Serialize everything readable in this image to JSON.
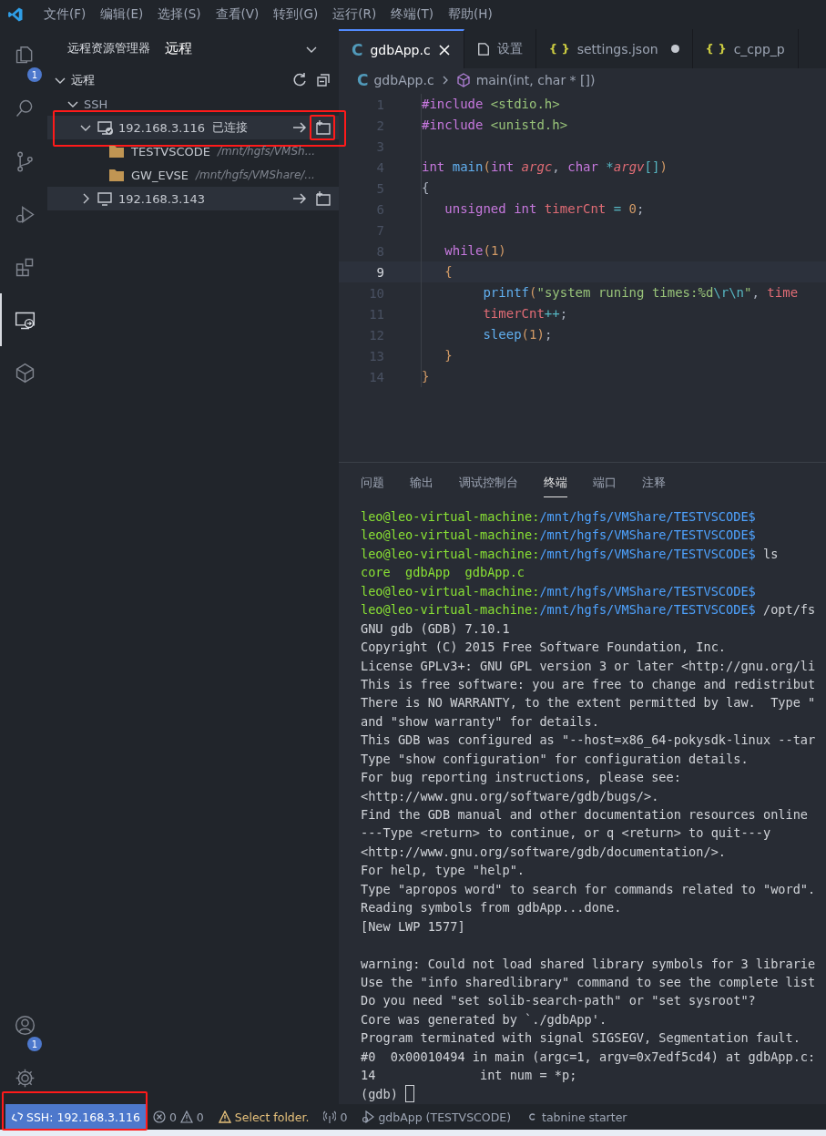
{
  "menubar": {
    "items": [
      "文件(F)",
      "编辑(E)",
      "选择(S)",
      "查看(V)",
      "转到(G)",
      "运行(R)",
      "终端(T)",
      "帮助(H)"
    ]
  },
  "activity_bar": {
    "top": [
      {
        "kind": "files",
        "selected": false,
        "badge": "1"
      },
      {
        "kind": "search",
        "selected": false
      },
      {
        "kind": "source-control",
        "selected": false
      },
      {
        "kind": "run-debug",
        "selected": false
      },
      {
        "kind": "extensions",
        "selected": false
      },
      {
        "kind": "remote",
        "selected": true
      },
      {
        "kind": "cube",
        "selected": false
      }
    ],
    "bottom": [
      {
        "kind": "account",
        "selected": false,
        "badge": "1"
      },
      {
        "kind": "settings",
        "selected": false
      }
    ]
  },
  "sidebar": {
    "title": "远程资源管理器",
    "view": "远程",
    "tree": [
      {
        "kind": "section",
        "label": "远程",
        "expanded": true,
        "children": [
          {
            "kind": "group",
            "label": "SSH",
            "expanded": true,
            "children": [
              {
                "kind": "host",
                "label": "192.168.3.116",
                "status": "已连接",
                "connected": true,
                "expanded": true,
                "highlighted": true,
                "children": [
                  {
                    "kind": "folder",
                    "label": "TESTVSCODE",
                    "description": "/mnt/hgfs/VMSh..."
                  },
                  {
                    "kind": "folder",
                    "label": "GW_EVSE",
                    "description": "/mnt/hgfs/VMShare/..."
                  }
                ]
              },
              {
                "kind": "host",
                "label": "192.168.3.143",
                "connected": false,
                "expanded": false,
                "highlighted": false
              }
            ]
          }
        ]
      }
    ]
  },
  "editor": {
    "tabs": [
      {
        "kind": "c",
        "icon": "C",
        "label": "gdbApp.c",
        "selected": true,
        "modified": false
      },
      {
        "kind": "settings",
        "label": "设置",
        "selected": false,
        "modified": false
      },
      {
        "kind": "json",
        "icon": "{ }",
        "label": "settings.json",
        "selected": false,
        "modified": true
      },
      {
        "kind": "json",
        "icon": "{ }",
        "label": "c_cpp_p",
        "selected": false,
        "modified": false
      }
    ],
    "breadcrumb": {
      "icon": "C",
      "file": "gdbApp.c",
      "symbol": "main(int, char * [])"
    },
    "lines": [
      {
        "number": "1",
        "current": false,
        "tokens": [
          {
            "kind": "keyword",
            "text": "#include"
          },
          {
            "kind": "string",
            "text": " <stdio.h>"
          }
        ]
      },
      {
        "number": "2",
        "current": false,
        "tokens": [
          {
            "kind": "keyword",
            "text": "#include"
          },
          {
            "kind": "string",
            "text": " <unistd.h>"
          }
        ]
      },
      {
        "number": "3",
        "current": false
      },
      {
        "number": "4",
        "current": false,
        "tokens": [
          {
            "kind": "keyword",
            "text": "int"
          },
          {
            "kind": "function",
            "text": " main"
          },
          {
            "kind": "paren",
            "text": "("
          },
          {
            "kind": "keyword",
            "text": "int"
          },
          {
            "kind": "param",
            "text": " argc"
          },
          {
            "kind": "plain",
            "text": ","
          },
          {
            "kind": "keyword",
            "text": " char"
          },
          {
            "kind": "operator",
            "text": " *"
          },
          {
            "kind": "param",
            "text": "argv"
          },
          {
            "kind": "bracket",
            "text": "[]"
          },
          {
            "kind": "paren",
            "text": ")"
          }
        ]
      },
      {
        "number": "5",
        "current": false,
        "tokens": [
          {
            "kind": "plain",
            "text": "{"
          }
        ]
      },
      {
        "number": "6",
        "current": false,
        "tokens": [
          {
            "kind": "keyword",
            "text": "   unsigned"
          },
          {
            "kind": "keyword",
            "text": " int"
          },
          {
            "kind": "variable",
            "text": " timerCnt"
          },
          {
            "kind": "operator",
            "text": " ="
          },
          {
            "kind": "number",
            "text": " 0"
          },
          {
            "kind": "plain",
            "text": ";"
          }
        ]
      },
      {
        "number": "7",
        "current": false
      },
      {
        "number": "8",
        "current": false,
        "tokens": [
          {
            "kind": "keyword",
            "text": "   while"
          },
          {
            "kind": "paren",
            "text": "("
          },
          {
            "kind": "number",
            "text": "1"
          },
          {
            "kind": "paren",
            "text": ")"
          }
        ]
      },
      {
        "number": "9",
        "current": true,
        "tokens": [
          {
            "kind": "paren",
            "text": "   {"
          }
        ]
      },
      {
        "number": "10",
        "current": false,
        "tokens": [
          {
            "kind": "function",
            "text": "        printf"
          },
          {
            "kind": "paren",
            "text": "("
          },
          {
            "kind": "string",
            "text": "\"system runing times:%d"
          },
          {
            "kind": "escape",
            "text": "\\r\\n"
          },
          {
            "kind": "string",
            "text": "\""
          },
          {
            "kind": "plain",
            "text": ","
          },
          {
            "kind": "variable",
            "text": " time"
          }
        ]
      },
      {
        "number": "11",
        "current": false,
        "tokens": [
          {
            "kind": "variable",
            "text": "        timerCnt"
          },
          {
            "kind": "operator",
            "text": "++"
          },
          {
            "kind": "plain",
            "text": ";"
          }
        ]
      },
      {
        "number": "12",
        "current": false,
        "tokens": [
          {
            "kind": "function",
            "text": "        sleep"
          },
          {
            "kind": "paren",
            "text": "("
          },
          {
            "kind": "number",
            "text": "1"
          },
          {
            "kind": "paren",
            "text": ")"
          },
          {
            "kind": "plain",
            "text": ";"
          }
        ]
      },
      {
        "number": "13",
        "current": false,
        "tokens": [
          {
            "kind": "paren",
            "text": "   }"
          }
        ]
      },
      {
        "number": "14",
        "current": false,
        "tokens": [
          {
            "kind": "paren",
            "text": "}"
          }
        ]
      }
    ]
  },
  "panel": {
    "tabs": [
      {
        "label": "问题",
        "selected": false
      },
      {
        "label": "输出",
        "selected": false
      },
      {
        "label": "调试控制台",
        "selected": false
      },
      {
        "label": "终端",
        "selected": true
      },
      {
        "label": "端口",
        "selected": false
      },
      {
        "label": "注释",
        "selected": false
      }
    ],
    "terminal": [
      {
        "kind": "prompt",
        "user": "leo@leo-virtual-machine:",
        "path": "/mnt/hgfs/VMShare/TESTVSCODE$"
      },
      {
        "kind": "prompt",
        "user": "leo@leo-virtual-machine:",
        "path": "/mnt/hgfs/VMShare/TESTVSCODE$"
      },
      {
        "kind": "prompt",
        "user": "leo@leo-virtual-machine:",
        "path": "/mnt/hgfs/VMShare/TESTVSCODE$",
        "command": " ls"
      },
      {
        "kind": "listing",
        "text": "core  gdbApp  gdbApp.c"
      },
      {
        "kind": "prompt",
        "user": "leo@leo-virtual-machine:",
        "path": "/mnt/hgfs/VMShare/TESTVSCODE$"
      },
      {
        "kind": "prompt",
        "user": "leo@leo-virtual-machine:",
        "path": "/mnt/hgfs/VMShare/TESTVSCODE$",
        "command": " /opt/fs"
      },
      {
        "kind": "output",
        "text": "GNU gdb (GDB) 7.10.1"
      },
      {
        "kind": "output",
        "text": "Copyright (C) 2015 Free Software Foundation, Inc."
      },
      {
        "kind": "output",
        "text": "License GPLv3+: GNU GPL version 3 or later <http://gnu.org/li"
      },
      {
        "kind": "output",
        "text": "This is free software: you are free to change and redistribut"
      },
      {
        "kind": "output",
        "text": "There is NO WARRANTY, to the extent permitted by law.  Type \""
      },
      {
        "kind": "output",
        "text": "and \"show warranty\" for details."
      },
      {
        "kind": "output",
        "text": "This GDB was configured as \"--host=x86_64-pokysdk-linux --tar"
      },
      {
        "kind": "output",
        "text": "Type \"show configuration\" for configuration details."
      },
      {
        "kind": "output",
        "text": "For bug reporting instructions, please see:"
      },
      {
        "kind": "output",
        "text": "<http://www.gnu.org/software/gdb/bugs/>."
      },
      {
        "kind": "output",
        "text": "Find the GDB manual and other documentation resources online"
      },
      {
        "kind": "output",
        "text": "---Type <return> to continue, or q <return> to quit---y"
      },
      {
        "kind": "output",
        "text": "<http://www.gnu.org/software/gdb/documentation/>."
      },
      {
        "kind": "output",
        "text": "For help, type \"help\"."
      },
      {
        "kind": "output",
        "text": "Type \"apropos word\" to search for commands related to \"word\"."
      },
      {
        "kind": "output",
        "text": "Reading symbols from gdbApp...done."
      },
      {
        "kind": "output",
        "text": "[New LWP 1577]"
      },
      {
        "kind": "blank"
      },
      {
        "kind": "output",
        "text": "warning: Could not load shared library symbols for 3 librarie"
      },
      {
        "kind": "output",
        "text": "Use the \"info sharedlibrary\" command to see the complete list"
      },
      {
        "kind": "output",
        "text": "Do you need \"set solib-search-path\" or \"set sysroot\"?"
      },
      {
        "kind": "output",
        "text": "Core was generated by `./gdbApp'."
      },
      {
        "kind": "output",
        "text": "Program terminated with signal SIGSEGV, Segmentation fault."
      },
      {
        "kind": "output",
        "text": "#0  0x00010494 in main (argc=1, argv=0x7edf5cd4) at gdbApp.c:"
      },
      {
        "kind": "output",
        "text": "14              int num = *p;"
      },
      {
        "kind": "input",
        "text": "(gdb)"
      }
    ]
  },
  "status_bar": {
    "items": [
      {
        "kind": "remote",
        "text": "SSH: 192.168.3.116",
        "highlighted": true
      },
      {
        "kind": "problems",
        "errors": "0",
        "warnings": "0"
      },
      {
        "kind": "notice",
        "text": "Select folder."
      },
      {
        "kind": "ports",
        "text": "0"
      },
      {
        "kind": "debug",
        "text": "gdbApp (TESTVSCODE)"
      },
      {
        "kind": "tabnine",
        "text": "tabnine starter"
      }
    ]
  }
}
